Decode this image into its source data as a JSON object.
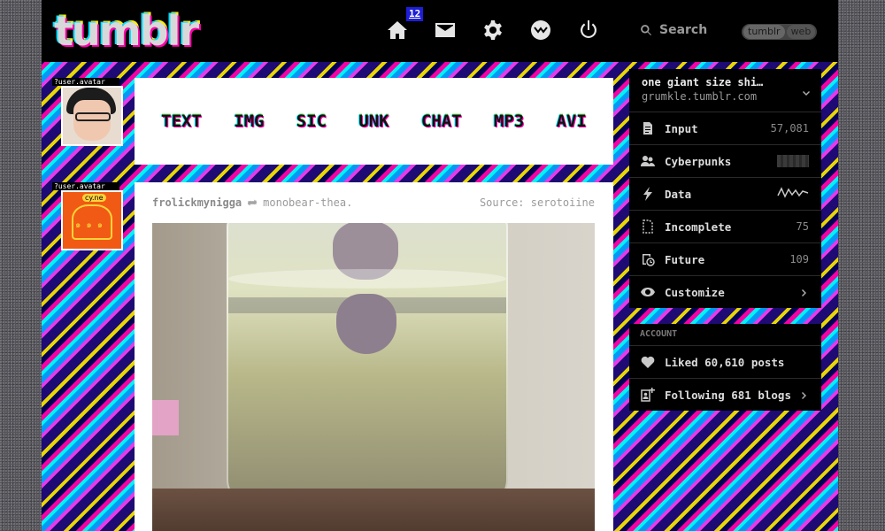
{
  "header": {
    "logo": "tumblr",
    "badge": "12",
    "search_placeholder": "Search",
    "switch": [
      "tumblr",
      "web"
    ]
  },
  "avatars": [
    {
      "label": "?user.avatar"
    },
    {
      "label": "?user.avatar"
    }
  ],
  "typebar": {
    "types": [
      "TEXT",
      "IMG",
      "SIC",
      "UNK",
      "CHAT",
      "MP3",
      "AVI"
    ]
  },
  "post": {
    "author": "frolickmynigga",
    "reblogged_from": "monobear-thea.",
    "source": "Source: serotoiine"
  },
  "sidebar": {
    "blog_title": "one giant size shi…",
    "blog_url": "grumkle.tumblr.com",
    "items": [
      {
        "label": "Input",
        "count": "57,081",
        "icon": "document-icon"
      },
      {
        "label": "Cyberpunks",
        "count": "",
        "icon": "people-icon"
      },
      {
        "label": "Data",
        "count": "",
        "icon": "bolt-icon"
      },
      {
        "label": "Incomplete",
        "count": "75",
        "icon": "drafts-icon"
      },
      {
        "label": "Future",
        "count": "109",
        "icon": "queue-icon"
      },
      {
        "label": "Customize",
        "count": "",
        "icon": "eye-icon"
      }
    ],
    "account_label": "ACCOUNT",
    "account_items": [
      {
        "label": "Liked 60,610 posts",
        "icon": "heart-icon"
      },
      {
        "label": "Following 681 blogs",
        "icon": "following-icon"
      }
    ]
  },
  "colors": {
    "header_bg": "#000000",
    "badge_bg": "#1e1ed8",
    "panel_bg": "#ffffff",
    "sidebar_bg": "#000000"
  }
}
